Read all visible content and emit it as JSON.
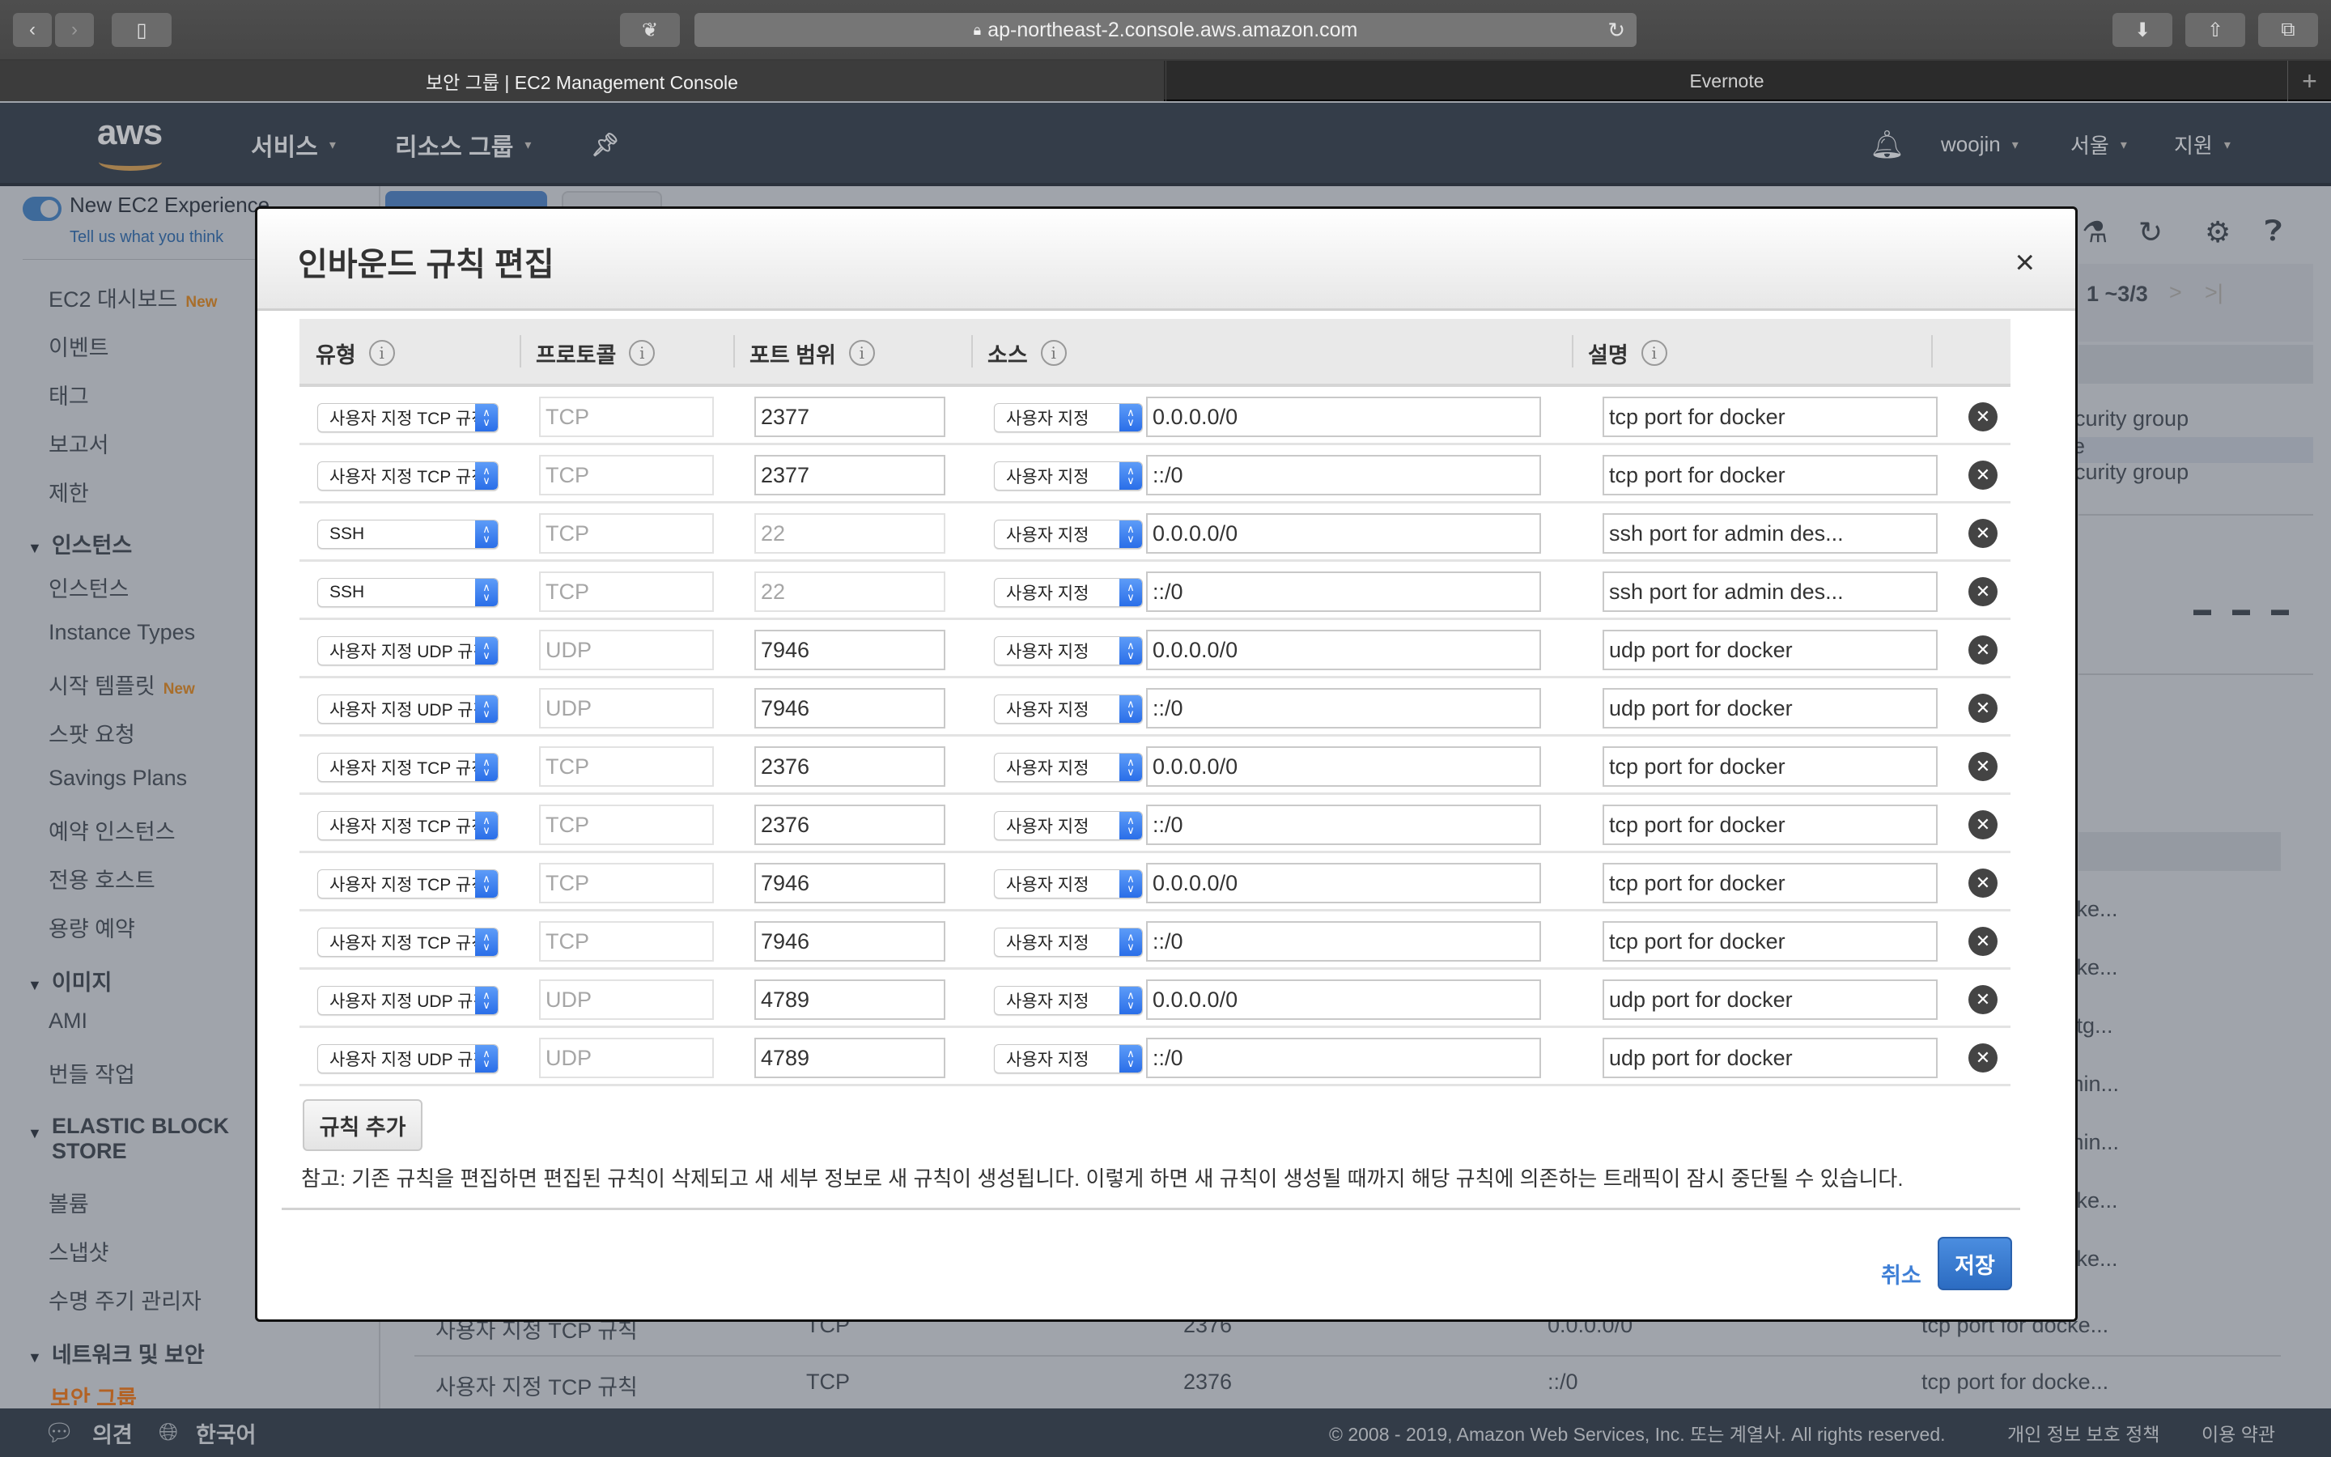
{
  "browser": {
    "url": "ap-northeast-2.console.aws.amazon.com",
    "tabs": [
      {
        "label": "보안 그룹 | EC2 Management Console",
        "active": true
      },
      {
        "label": "Evernote",
        "active": false
      }
    ]
  },
  "aws_nav": {
    "services": "서비스",
    "resource_groups": "리소스 그룹",
    "user": "woojin",
    "region": "서울",
    "support": "지원"
  },
  "sidebar": {
    "new_experience": "New EC2 Experience",
    "feedback_link": "Tell us what you think",
    "new_badge": "New",
    "items_top": [
      "EC2 대시보드",
      "이벤트",
      "태그",
      "보고서",
      "제한"
    ],
    "sections": [
      {
        "title": "인스턴스",
        "items": [
          "인스턴스",
          "Instance Types",
          "시작 템플릿",
          "스팟 요청",
          "Savings Plans",
          "예약 인스턴스",
          "전용 호스트",
          "용량 예약"
        ]
      },
      {
        "title": "이미지",
        "items": [
          "AMI",
          "번들 작업"
        ]
      },
      {
        "title": "ELASTIC BLOCK STORE",
        "items": [
          "볼륨",
          "스냅샷",
          "수명 주기 관리자"
        ]
      },
      {
        "title": "네트워크 및 보안",
        "items": [
          "보안 그룹"
        ]
      }
    ]
  },
  "background": {
    "pagination": "1 ~3/3",
    "list_fragments": [
      "ecurity group",
      "ne",
      "ecurity group"
    ],
    "desc_fragments": [
      "cke...",
      "cke...",
      "stg...",
      "min...",
      "min...",
      "cke...",
      "cke..."
    ],
    "rows": [
      {
        "type": "사용자 지정 TCP 규칙",
        "protocol": "TCP",
        "port": "2376",
        "source": "0.0.0.0/0",
        "desc": "tcp port for docke..."
      },
      {
        "type": "사용자 지정 TCP 규칙",
        "protocol": "TCP",
        "port": "2376",
        "source": "::/0",
        "desc": "tcp port for docke..."
      }
    ]
  },
  "dialog": {
    "title": "인바운드 규칙 편집",
    "close": "×",
    "columns": [
      "유형",
      "프로토콜",
      "포트 범위",
      "소스",
      "설명"
    ],
    "info_glyph": "i",
    "rules": [
      {
        "type": "사용자 지정 TCP 규칙",
        "protocol": "TCP",
        "port": "2377",
        "port_editable": true,
        "source_type": "사용자 지정",
        "source": "0.0.0.0/0",
        "description": "tcp port for docker"
      },
      {
        "type": "사용자 지정 TCP 규칙",
        "protocol": "TCP",
        "port": "2377",
        "port_editable": true,
        "source_type": "사용자 지정",
        "source": "::/0",
        "description": "tcp port for docker"
      },
      {
        "type": "SSH",
        "protocol": "TCP",
        "port": "22",
        "port_editable": false,
        "source_type": "사용자 지정",
        "source": "0.0.0.0/0",
        "description": "ssh port for admin des..."
      },
      {
        "type": "SSH",
        "protocol": "TCP",
        "port": "22",
        "port_editable": false,
        "source_type": "사용자 지정",
        "source": "::/0",
        "description": "ssh port for admin des..."
      },
      {
        "type": "사용자 지정 UDP 규칙",
        "protocol": "UDP",
        "port": "7946",
        "port_editable": true,
        "source_type": "사용자 지정",
        "source": "0.0.0.0/0",
        "description": "udp port for docker"
      },
      {
        "type": "사용자 지정 UDP 규칙",
        "protocol": "UDP",
        "port": "7946",
        "port_editable": true,
        "source_type": "사용자 지정",
        "source": "::/0",
        "description": "udp port for docker"
      },
      {
        "type": "사용자 지정 TCP 규칙",
        "protocol": "TCP",
        "port": "2376",
        "port_editable": true,
        "source_type": "사용자 지정",
        "source": "0.0.0.0/0",
        "description": "tcp port for docker"
      },
      {
        "type": "사용자 지정 TCP 규칙",
        "protocol": "TCP",
        "port": "2376",
        "port_editable": true,
        "source_type": "사용자 지정",
        "source": "::/0",
        "description": "tcp port for docker"
      },
      {
        "type": "사용자 지정 TCP 규칙",
        "protocol": "TCP",
        "port": "7946",
        "port_editable": true,
        "source_type": "사용자 지정",
        "source": "0.0.0.0/0",
        "description": "tcp port for docker"
      },
      {
        "type": "사용자 지정 TCP 규칙",
        "protocol": "TCP",
        "port": "7946",
        "port_editable": true,
        "source_type": "사용자 지정",
        "source": "::/0",
        "description": "tcp port for docker"
      },
      {
        "type": "사용자 지정 UDP 규칙",
        "protocol": "UDP",
        "port": "4789",
        "port_editable": true,
        "source_type": "사용자 지정",
        "source": "0.0.0.0/0",
        "description": "udp port for docker"
      },
      {
        "type": "사용자 지정 UDP 규칙",
        "protocol": "UDP",
        "port": "4789",
        "port_editable": true,
        "source_type": "사용자 지정",
        "source": "::/0",
        "description": "udp port for docker"
      }
    ],
    "add_rule": "규칙 추가",
    "note": "참고: 기존 규칙을 편집하면 편집된 규칙이 삭제되고 새 세부 정보로 새 규칙이 생성됩니다. 이렇게 하면 새 규칙이 생성될 때까지 해당 규칙에 의존하는 트래픽이 잠시 중단될 수 있습니다.",
    "cancel": "취소",
    "save": "저장"
  },
  "footer": {
    "feedback": "의견",
    "language": "한국어",
    "copyright": "© 2008 - 2019, Amazon Web Services, Inc. 또는 계열사. All rights reserved.",
    "privacy": "개인 정보 보호 정책",
    "terms": "이용 약관"
  },
  "colors": {
    "aws_nav": "#343d49",
    "overlay_bg": "#a0a4ab",
    "primary_button": "#3a7bd5",
    "link": "#3e7fd6",
    "new_badge": "#a86e2b",
    "stepper_blue": "#2a6ee8"
  }
}
